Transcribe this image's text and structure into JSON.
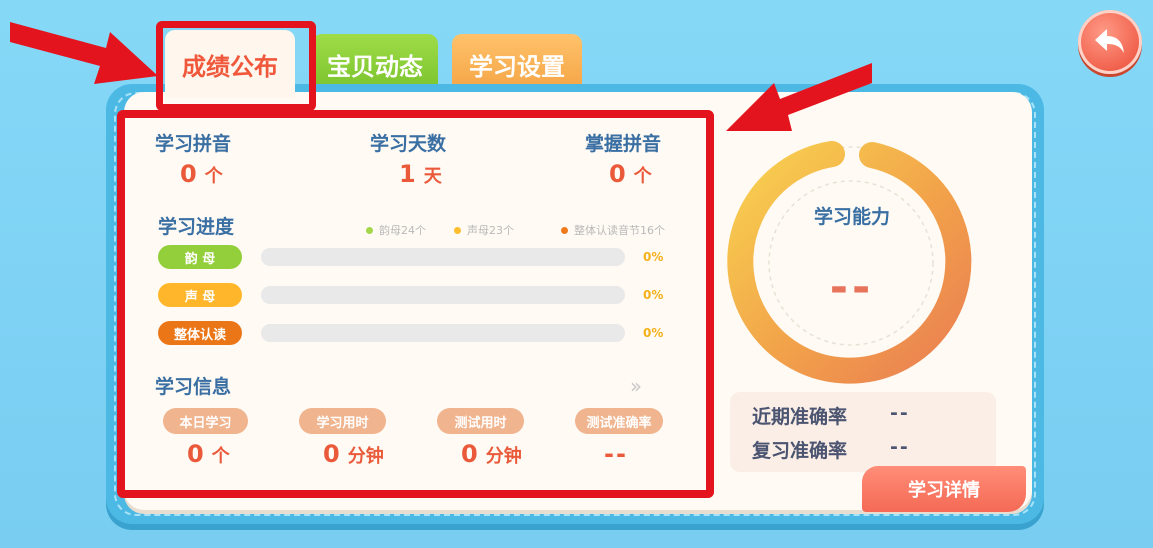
{
  "tabs": [
    {
      "label": "成绩公布",
      "active": true
    },
    {
      "label": "宝贝动态",
      "active": false
    },
    {
      "label": "学习设置",
      "active": false
    }
  ],
  "stats": [
    {
      "label": "学习拼音",
      "value": "0",
      "unit": "个"
    },
    {
      "label": "学习天数",
      "value": "1",
      "unit": "天"
    },
    {
      "label": "掌握拼音",
      "value": "0",
      "unit": "个"
    }
  ],
  "progress": {
    "title": "学习进度",
    "legend": [
      {
        "text": "韵母24个",
        "color": "#a3d64a"
      },
      {
        "text": "声母23个",
        "color": "#ffbe2e"
      },
      {
        "text": "整体认读音节16个",
        "color": "#ee7a1c"
      }
    ],
    "rows": [
      {
        "label": "韵 母",
        "color": "#93cf3a",
        "percent_text": "0%",
        "percent": 0
      },
      {
        "label": "声 母",
        "color": "#ffb62a",
        "percent_text": "0%",
        "percent": 0
      },
      {
        "label": "整体认读",
        "color": "#ea7617",
        "percent_text": "0%",
        "percent": 0
      }
    ]
  },
  "info": {
    "title": "学习信息",
    "more_icon": "double-chevron-right-icon",
    "items": [
      {
        "label": "本日学习",
        "value": "0",
        "unit": "个"
      },
      {
        "label": "学习用时",
        "value": "0",
        "unit": "分钟"
      },
      {
        "label": "测试用时",
        "value": "0",
        "unit": "分钟"
      },
      {
        "label": "测试准确率",
        "value": "--",
        "unit": ""
      }
    ]
  },
  "ability": {
    "title": "学习能力",
    "value": "--",
    "ring_colors": [
      "#f7c84a",
      "#ee8a52"
    ]
  },
  "accuracy": [
    {
      "label": "近期准确率",
      "value": "--"
    },
    {
      "label": "复习准确率",
      "value": "--"
    }
  ],
  "detail_button": "学习详情",
  "back_icon": "back-arrow-icon",
  "colors": {
    "highlight": "#e4141e",
    "board": "#4cb9e4",
    "accent": "#ea5a3a"
  }
}
